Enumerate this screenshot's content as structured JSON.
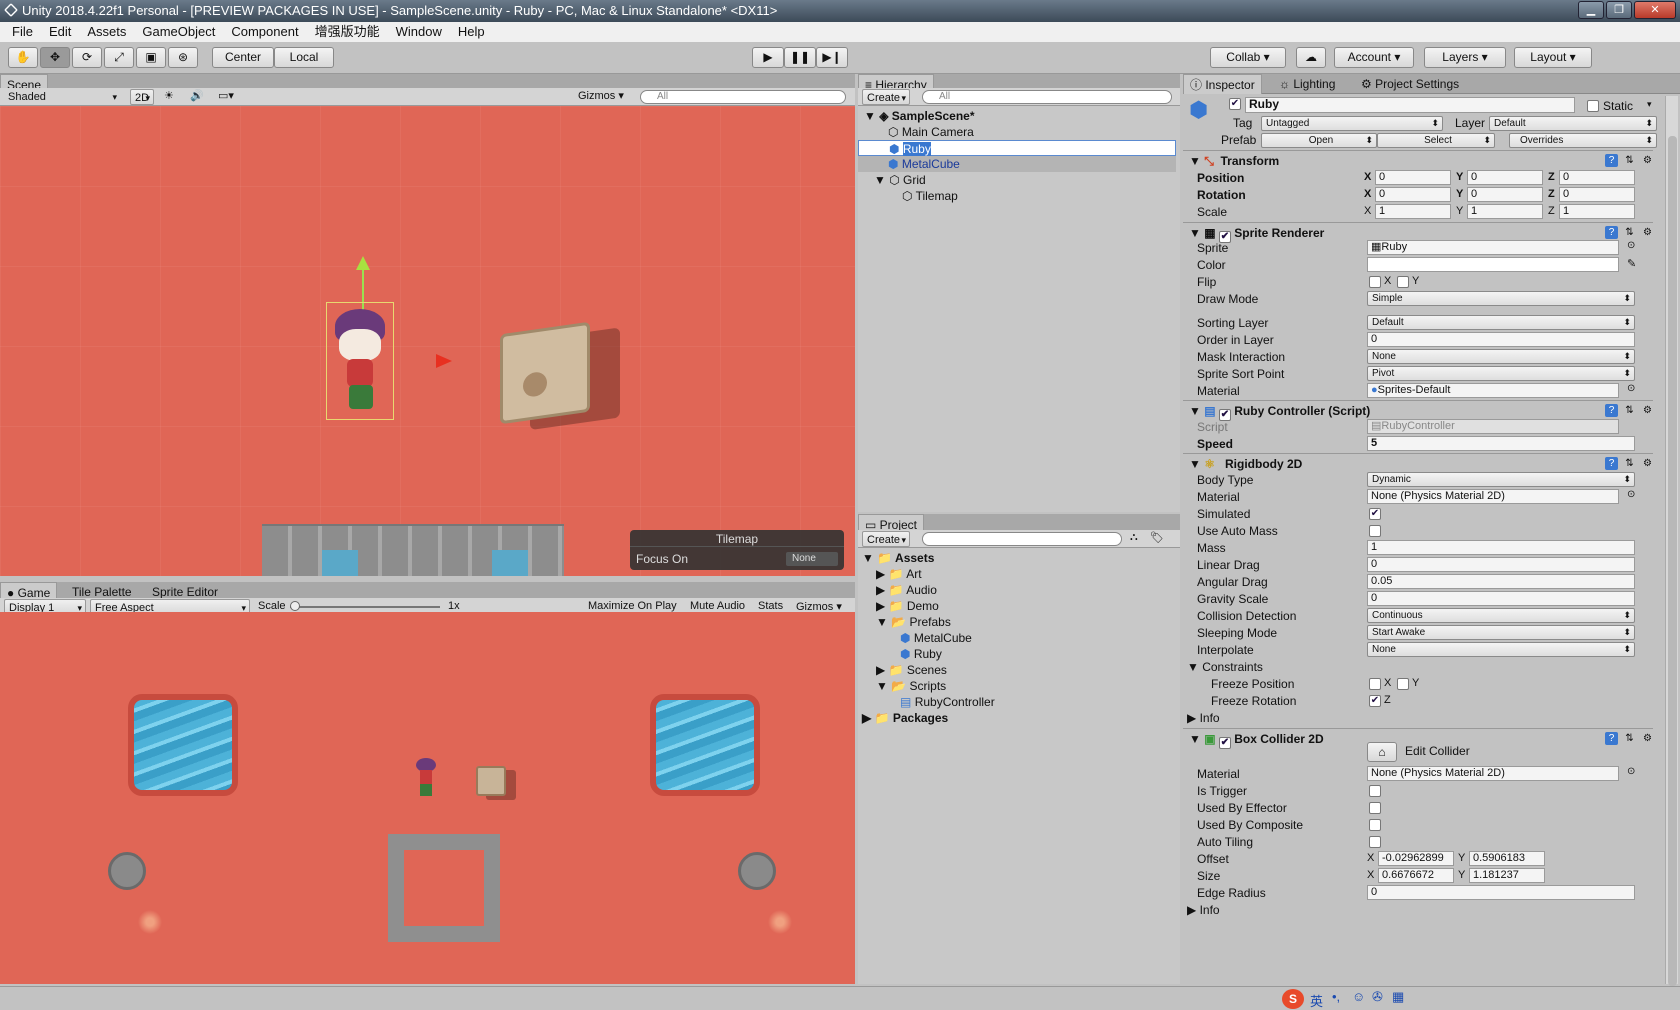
{
  "window": {
    "title": "Unity 2018.4.22f1 Personal - [PREVIEW PACKAGES IN USE] - SampleScene.unity - Ruby - PC, Mac & Linux Standalone* <DX11>"
  },
  "menu": [
    "File",
    "Edit",
    "Assets",
    "GameObject",
    "Component",
    "增强版功能",
    "Window",
    "Help"
  ],
  "toolbar": {
    "pivot": "Center",
    "space": "Local",
    "collab": "Collab",
    "account": "Account",
    "layers": "Layers",
    "layout": "Layout"
  },
  "scene": {
    "tab": "Scene",
    "shading": "Shaded",
    "mode2d": "2D",
    "gizmos": "Gizmos",
    "search": "All",
    "overlay_title": "Tilemap",
    "overlay_label": "Focus On",
    "overlay_value": "None"
  },
  "game": {
    "tabs": [
      "Game",
      "Tile Palette",
      "Sprite Editor"
    ],
    "display": "Display 1",
    "aspect": "Free Aspect",
    "scale_label": "Scale",
    "scale_value": "1x",
    "maximize": "Maximize On Play",
    "mute": "Mute Audio",
    "stats": "Stats",
    "gizmos": "Gizmos"
  },
  "hierarchy": {
    "tab": "Hierarchy",
    "create": "Create",
    "search": "All",
    "scene": "SampleScene*",
    "items": [
      "Main Camera",
      "Ruby",
      "MetalCube",
      "Grid",
      "Tilemap"
    ]
  },
  "project": {
    "tab": "Project",
    "create": "Create",
    "items": [
      "Assets",
      "Art",
      "Audio",
      "Demo",
      "Prefabs",
      "MetalCube",
      "Ruby",
      "Scenes",
      "Scripts",
      "RubyController",
      "Packages"
    ]
  },
  "inspector": {
    "tabs": [
      "Inspector",
      "Lighting",
      "Project Settings"
    ],
    "name": "Ruby",
    "static": "Static",
    "tag_label": "Tag",
    "tag": "Untagged",
    "layer_label": "Layer",
    "layer": "Default",
    "prefab_label": "Prefab",
    "open": "Open",
    "select": "Select",
    "overrides": "Overrides",
    "transform": {
      "title": "Transform",
      "position": "Position",
      "rotation": "Rotation",
      "scale": "Scale",
      "pos": [
        "0",
        "0",
        "0"
      ],
      "rot": [
        "0",
        "0",
        "0"
      ],
      "scl": [
        "1",
        "1",
        "1"
      ]
    },
    "sprite_renderer": {
      "title": "Sprite Renderer",
      "sprite_label": "Sprite",
      "sprite": "Ruby",
      "color_label": "Color",
      "flip_label": "Flip",
      "draw_mode_label": "Draw Mode",
      "draw_mode": "Simple",
      "sorting_layer_label": "Sorting Layer",
      "sorting_layer": "Default",
      "order_label": "Order in Layer",
      "order": "0",
      "mask_label": "Mask Interaction",
      "mask": "None",
      "sort_point_label": "Sprite Sort Point",
      "sort_point": "Pivot",
      "material_label": "Material",
      "material": "Sprites-Default"
    },
    "ruby_controller": {
      "title": "Ruby Controller (Script)",
      "script_label": "Script",
      "script": "RubyController",
      "speed_label": "Speed",
      "speed": "5"
    },
    "rigidbody": {
      "title": "Rigidbody 2D",
      "body_type_label": "Body Type",
      "body_type": "Dynamic",
      "material_label": "Material",
      "material": "None (Physics Material 2D)",
      "simulated_label": "Simulated",
      "auto_mass_label": "Use Auto Mass",
      "mass_label": "Mass",
      "mass": "1",
      "linear_drag_label": "Linear Drag",
      "linear_drag": "0",
      "angular_drag_label": "Angular Drag",
      "angular_drag": "0.05",
      "gravity_label": "Gravity Scale",
      "gravity": "0",
      "collision_label": "Collision Detection",
      "collision": "Continuous",
      "sleeping_label": "Sleeping Mode",
      "sleeping": "Start Awake",
      "interpolate_label": "Interpolate",
      "interpolate": "None",
      "constraints_label": "Constraints",
      "freeze_pos_label": "Freeze Position",
      "freeze_rot_label": "Freeze Rotation",
      "info_label": "Info"
    },
    "box_collider": {
      "title": "Box Collider 2D",
      "edit_collider": "Edit Collider",
      "material_label": "Material",
      "material": "None (Physics Material 2D)",
      "trigger_label": "Is Trigger",
      "effector_label": "Used By Effector",
      "composite_label": "Used By Composite",
      "auto_tiling_label": "Auto Tiling",
      "offset_label": "Offset",
      "offset_x": "-0.02962899",
      "offset_y": "0.5906183",
      "size_label": "Size",
      "size_x": "0.6676672",
      "size_y": "1.181237",
      "edge_label": "Edge Radius",
      "edge": "0",
      "info_label": "Info"
    },
    "axis": [
      "X",
      "Y",
      "Z"
    ]
  },
  "taskbar": {
    "ime": "英"
  }
}
